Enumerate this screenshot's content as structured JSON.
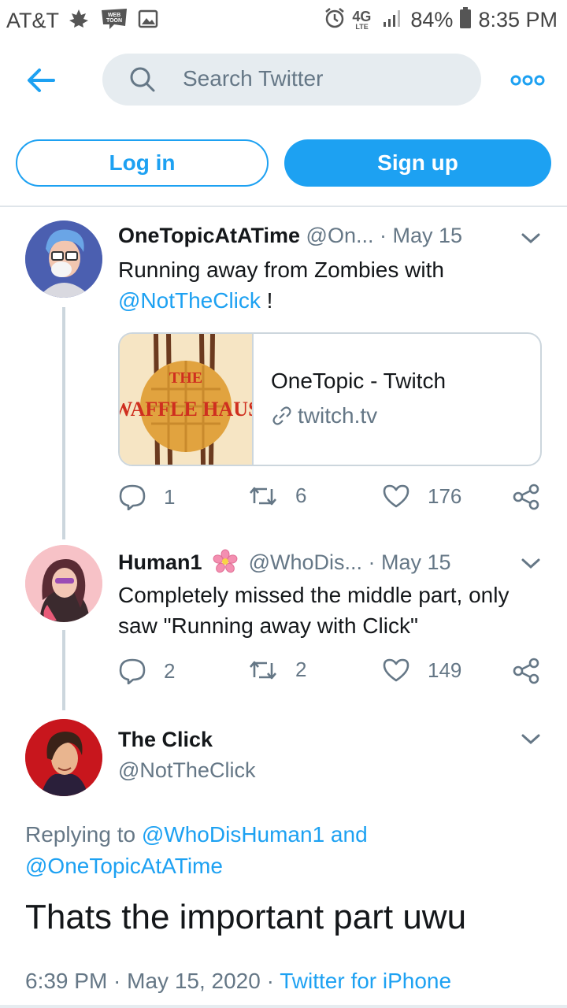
{
  "status_bar": {
    "carrier": "AT&T",
    "network": "4G",
    "network_sub": "LTE",
    "battery": "84%",
    "time": "8:35 PM",
    "webtoon_label": "WEB TOON"
  },
  "header": {
    "search_placeholder": "Search Twitter"
  },
  "auth": {
    "login_label": "Log in",
    "signup_label": "Sign up"
  },
  "tweets": [
    {
      "name": "OneTopicAtATime",
      "handle": "@On...",
      "date": "May 15",
      "text_before": "Running away from Zombies with",
      "mention": "@NotTheClick",
      "text_after": " !",
      "card": {
        "title": "OneTopic - Twitch",
        "url": "twitch.tv",
        "image_text_top": "THE",
        "image_text_bottom": "WAFFLE HAUS"
      },
      "replies": "1",
      "retweets": "6",
      "likes": "176"
    },
    {
      "name": "Human1",
      "handle": "@WhoDis...",
      "date": "May 15",
      "text": "Completely missed the middle part, only saw \"Running away with Click\"",
      "replies": "2",
      "retweets": "2",
      "likes": "149"
    }
  ],
  "focused": {
    "name": "The Click",
    "handle": "@NotTheClick",
    "replying_prefix": "Replying to ",
    "replying_user1": "@WhoDisHuman1",
    "replying_and": " and",
    "replying_user2": "@OneTopicAtATime",
    "text": "Thats the important part uwu",
    "timestamp": "6:39 PM · May 15, 2020 · ",
    "source": "Twitter for iPhone"
  },
  "colors": {
    "accent": "#1da1f2",
    "muted": "#657786",
    "text": "#14171a"
  }
}
